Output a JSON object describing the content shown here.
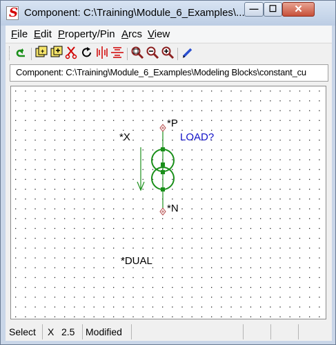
{
  "window": {
    "title": "Component: C:\\Training\\Module_6_Examples\\...",
    "minimize_glyph": "—",
    "maximize_glyph": "☐",
    "close_glyph": "✕"
  },
  "menu": {
    "items": [
      {
        "label": "File",
        "accel": "F",
        "rest": "ile"
      },
      {
        "label": "Edit",
        "accel": "E",
        "rest": "dit"
      },
      {
        "label": "Property/Pin",
        "accel": "P",
        "rest": "roperty/Pin"
      },
      {
        "label": "Arcs",
        "accel": "A",
        "rest": "rcs"
      },
      {
        "label": "View",
        "accel": "V",
        "rest": "iew"
      }
    ]
  },
  "toolbar": {
    "buttons": [
      {
        "name": "undo-icon",
        "color": "#1a8f1a"
      },
      {
        "name": "add-pin-icon",
        "color": "#c8a000"
      },
      {
        "name": "add-property-icon",
        "color": "#c8a000"
      },
      {
        "name": "cut-icon",
        "color": "#d00000"
      },
      {
        "name": "rotate-icon",
        "color": "#000000"
      },
      {
        "name": "mirror-icon",
        "color": "#d00000"
      },
      {
        "name": "flip-icon",
        "color": "#d00000"
      },
      {
        "name": "zoom-region-icon",
        "color": "#8b2020"
      },
      {
        "name": "zoom-out-icon",
        "color": "#8b2020"
      },
      {
        "name": "zoom-in-icon",
        "color": "#8b2020"
      },
      {
        "name": "edit-pencil-icon",
        "color": "#2a4fd0"
      }
    ]
  },
  "path": {
    "text": "Component: C:\\Training\\Module_6_Examples\\Modeling Blocks\\constant_cu"
  },
  "schematic": {
    "labels": {
      "pin_p": "*P",
      "pin_n": "*N",
      "node_x": "*X",
      "load": "LOAD?",
      "dual": "*DUAL"
    },
    "colors": {
      "symbol": "#1a8f1a",
      "pin": "#b04040",
      "load_text": "#1010c8",
      "grid_dot": "#222222"
    }
  },
  "status": {
    "mode": "Select",
    "axis": "X",
    "value": "2.5",
    "state": "Modified"
  }
}
